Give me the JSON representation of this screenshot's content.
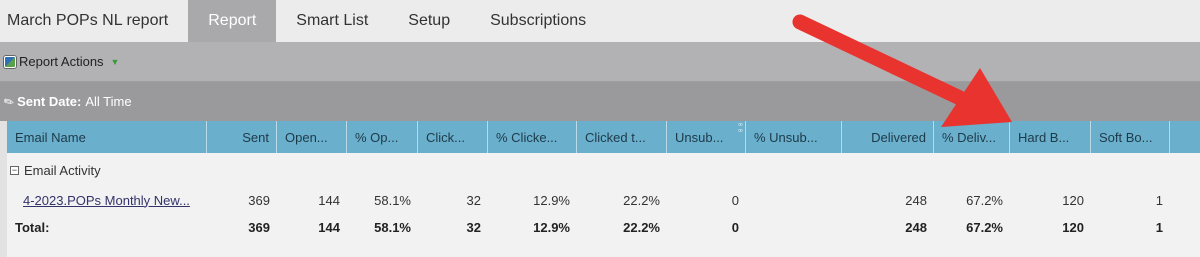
{
  "tabs": [
    {
      "label": "March POPs NL report",
      "active": false
    },
    {
      "label": "Report",
      "active": true
    },
    {
      "label": "Smart List",
      "active": false
    },
    {
      "label": "Setup",
      "active": false
    },
    {
      "label": "Subscriptions",
      "active": false
    }
  ],
  "toolbar": {
    "actions_label": "Report Actions",
    "actions_icon": "report-icon",
    "dropdown_icon": "triangle-down-icon"
  },
  "filter": {
    "label": "Sent Date:",
    "value": "All Time",
    "icon": "filter-icon"
  },
  "columns": [
    "Email Name",
    "Sent",
    "Open...",
    "% Op...",
    "Click...",
    "% Clicke...",
    "Clicked t...",
    "Unsub...",
    "% Unsub...",
    "Delivered",
    "% Deliv...",
    "Hard B...",
    "Soft Bo..."
  ],
  "group": {
    "label": "Email Activity",
    "icon": "collapse-minus-icon"
  },
  "rows": [
    {
      "email_name": "4-2023.POPs Monthly New...",
      "sent": "369",
      "opened": "144",
      "pct_opened": "58.1%",
      "clicked": "32",
      "pct_clicked": "12.9%",
      "clicked_to_open": "22.2%",
      "unsubscribed": "0",
      "pct_unsubscribed": "",
      "delivered": "248",
      "pct_delivered": "67.2%",
      "hard_bounced": "120",
      "soft_bounced": "1"
    }
  ],
  "total": {
    "label": "Total:",
    "sent": "369",
    "opened": "144",
    "pct_opened": "58.1%",
    "clicked": "32",
    "pct_clicked": "12.9%",
    "clicked_to_open": "22.2%",
    "unsubscribed": "0",
    "pct_unsubscribed": "",
    "delivered": "248",
    "pct_delivered": "67.2%",
    "hard_bounced": "120",
    "soft_bounced": "1"
  },
  "colors": {
    "header_bg": "#6aafcb",
    "active_tab": "#a9a9ab",
    "arrow": "#e8332e"
  }
}
